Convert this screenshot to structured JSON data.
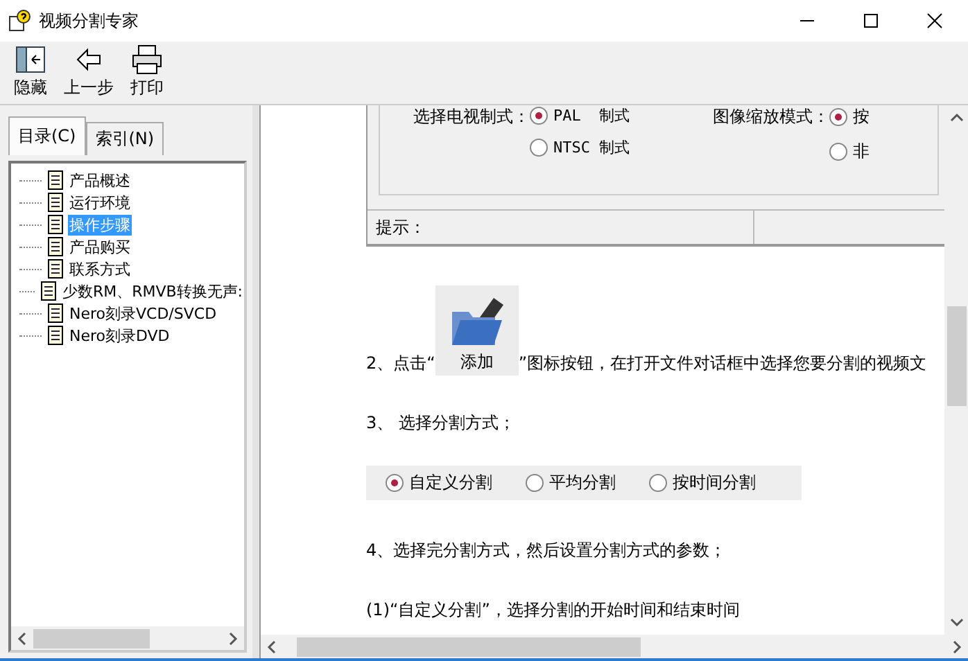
{
  "window": {
    "title": "视频分割专家"
  },
  "toolbar": [
    {
      "kind": "hide",
      "label": "隐藏"
    },
    {
      "kind": "back",
      "label": "上一步"
    },
    {
      "kind": "print",
      "label": "打印"
    }
  ],
  "tabs": [
    {
      "label": "目录(C)",
      "selected": true
    },
    {
      "label": "索引(N)",
      "selected": false
    }
  ],
  "tree": [
    {
      "label": "产品概述",
      "selected": false
    },
    {
      "label": "运行环境",
      "selected": false
    },
    {
      "label": "操作步骤",
      "selected": true
    },
    {
      "label": "产品购买",
      "selected": false
    },
    {
      "label": "联系方式",
      "selected": false
    },
    {
      "label": "少数RM、RMVB转换无声:",
      "selected": false
    },
    {
      "label": "Nero刻录VCD/SVCD",
      "selected": false
    },
    {
      "label": "Nero刻录DVD",
      "selected": false
    }
  ],
  "content": {
    "settings_panel": {
      "tv_label": "选择电视制式：",
      "tv_options": [
        {
          "label": "PAL  制式",
          "selected": true
        },
        {
          "label": "NTSC 制式",
          "selected": false
        }
      ],
      "scale_label": "图像缩放模式：",
      "scale_options": [
        {
          "label": "按",
          "selected": true
        },
        {
          "label": "非",
          "selected": false
        }
      ],
      "hint_label": "提示："
    },
    "step2": {
      "before": "2、点击“",
      "button_label": "添加",
      "after": "”图标按钮，在打开文件对话框中选择您要分割的视频文"
    },
    "step3": "3、 选择分割方式；",
    "split_modes": [
      {
        "label": "自定义分割",
        "selected": true
      },
      {
        "label": "平均分割",
        "selected": false
      },
      {
        "label": "按时间分割",
        "selected": false
      }
    ],
    "step4": "4、选择完分割方式，然后设置分割方式的参数；",
    "step4_1": "(1)“自定义分割”，选择分割的开始时间和结束时间"
  }
}
